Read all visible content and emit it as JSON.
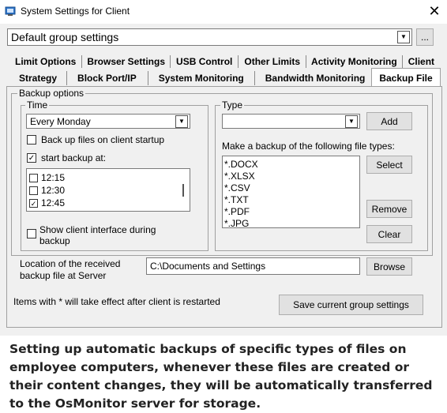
{
  "window": {
    "title": "System Settings for Client",
    "close_glyph": "✕"
  },
  "group_select": {
    "value": "Default group settings",
    "more_label": "..."
  },
  "tabs": {
    "row1": [
      "Limit Options",
      "Browser Settings",
      "USB Control",
      "Other Limits",
      "Activity Monitoring",
      "Client"
    ],
    "row2": [
      "Strategy",
      "Block Port/IP",
      "System Monitoring",
      "Bandwidth Monitoring",
      "Backup File"
    ],
    "active": "Backup File"
  },
  "backup": {
    "group_label": "Backup options",
    "time": {
      "label": "Time",
      "schedule_value": "Every Monday",
      "startup_label": "Back up files on client startup",
      "startup_checked": false,
      "start_at_label": "start backup at:",
      "start_at_checked": true,
      "times": [
        {
          "label": "12:15",
          "checked": false,
          "mark": ""
        },
        {
          "label": "12:30",
          "checked": false,
          "mark": ""
        },
        {
          "label": "12:45",
          "checked": true,
          "mark": "✓"
        }
      ],
      "show_client_label_line1": "Show client interface during",
      "show_client_label_line2": "backup",
      "show_client_checked": false
    },
    "type": {
      "label": "Type",
      "type_value": "",
      "add_label": "Add",
      "make_backup_label": "Make a backup of the following file types:",
      "file_types": [
        "*.DOCX",
        "*.XLSX",
        "*.CSV",
        "*.TXT",
        "*.PDF",
        "*.JPG"
      ],
      "select_label": "Select",
      "remove_label": "Remove",
      "clear_label": "Clear"
    },
    "location": {
      "label_line1": "Location of the received",
      "label_line2": "backup file at Server",
      "value": "C:\\Documents and Settings",
      "browse_label": "Browse"
    }
  },
  "footer": {
    "note": "Items with * will take effect after client is restarted",
    "save_label": "Save current group settings"
  },
  "caption": "Setting up automatic backups of specific types of files on employee computers, whenever these files are created or their content changes, they will be automatically transferred to the OsMonitor server for storage."
}
